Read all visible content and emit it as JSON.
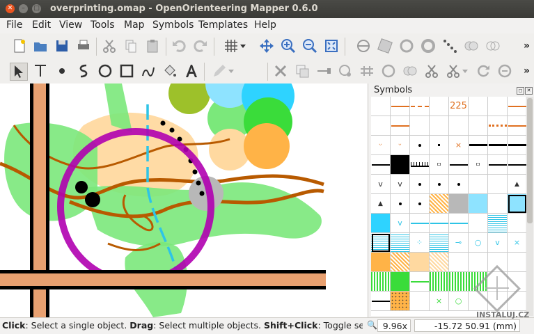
{
  "window": {
    "title": "overprinting.omap - OpenOrienteering Mapper 0.6.0"
  },
  "menubar": [
    "File",
    "Edit",
    "View",
    "Tools",
    "Map",
    "Symbols",
    "Templates",
    "Help"
  ],
  "toolbar_more": "»",
  "panel": {
    "title": "Symbols",
    "cell_text": [
      "225"
    ]
  },
  "status": {
    "hint_click": "Click",
    "hint_click_text": ": Select a single object. ",
    "hint_drag": "Drag",
    "hint_drag_text": ": Select multiple objects. ",
    "hint_shift": "Shift+Click",
    "hint_shift_text": ": Toggle sele",
    "zoom": "9.96x",
    "coords": "-15.72 50.91 (mm)"
  },
  "watermark": "INSTALUJ.CZ",
  "colors": {
    "accent": "#e95420",
    "purple": "#b000b0",
    "green": "#7be87b",
    "brown": "#b85a00"
  }
}
